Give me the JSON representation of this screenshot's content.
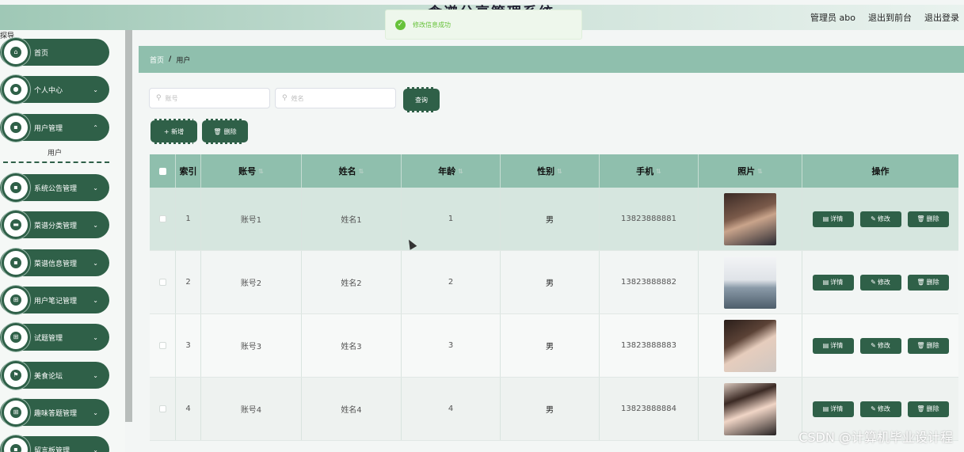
{
  "header": {
    "system_title": "食谱分享管理系统",
    "admin_label": "管理员 abo",
    "exit_front": "退出到前台",
    "logout": "退出登录"
  },
  "toast": {
    "message": "修改信息成功"
  },
  "sidebar": {
    "section_label": "探导",
    "items": [
      {
        "label": "首页",
        "icon": "home-icon"
      },
      {
        "label": "个人中心",
        "icon": "user-icon"
      },
      {
        "label": "用户管理",
        "icon": "user-manage-icon"
      },
      {
        "label": "系统公告管理",
        "icon": "notice-icon"
      },
      {
        "label": "菜谱分类管理",
        "icon": "category-icon"
      },
      {
        "label": "菜谱信息管理",
        "icon": "recipe-icon"
      },
      {
        "label": "用户笔记管理",
        "icon": "grid-icon"
      },
      {
        "label": "试题管理",
        "icon": "grid-icon"
      },
      {
        "label": "美食论坛",
        "icon": "flag-icon"
      },
      {
        "label": "趣味答题管理",
        "icon": "grid-icon"
      },
      {
        "label": "留言板管理",
        "icon": "message-icon"
      }
    ],
    "submenu": "用户"
  },
  "breadcrumb": {
    "home": "首页",
    "sep": "/",
    "current": "用户"
  },
  "search": {
    "account_placeholder": "账号",
    "name_placeholder": "姓名",
    "query_label": "查询"
  },
  "actions": {
    "add_label": "+ 新增",
    "delete_label": "删除"
  },
  "table": {
    "headers": [
      "索引",
      "账号",
      "姓名",
      "年龄",
      "性别",
      "手机",
      "照片",
      "操作"
    ],
    "rows": [
      {
        "index": "1",
        "account": "账号1",
        "name": "姓名1",
        "age": "1",
        "gender": "男",
        "phone": "13823888881"
      },
      {
        "index": "2",
        "account": "账号2",
        "name": "姓名2",
        "age": "2",
        "gender": "男",
        "phone": "13823888882"
      },
      {
        "index": "3",
        "account": "账号3",
        "name": "姓名3",
        "age": "3",
        "gender": "男",
        "phone": "13823888883"
      },
      {
        "index": "4",
        "account": "账号4",
        "name": "姓名4",
        "age": "4",
        "gender": "男",
        "phone": "13823888884"
      }
    ],
    "op_detail": "详情",
    "op_edit": "修改",
    "op_delete": "删除"
  },
  "watermark": "CSDN @计算机毕业设计程"
}
